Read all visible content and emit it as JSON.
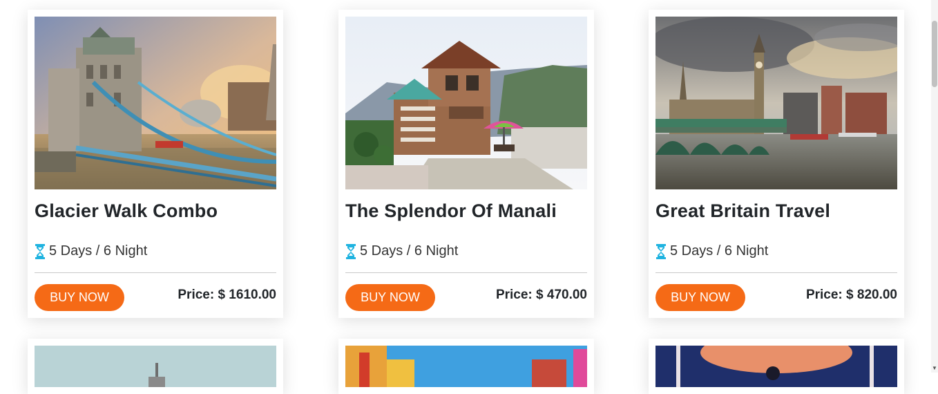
{
  "tours": [
    {
      "title": "Glacier Walk Combo",
      "duration": "5 Days / 6 Night",
      "button": "BUY NOW",
      "price": "Price: $ 1610.00",
      "image": "tower-bridge-photo"
    },
    {
      "title": "The Splendor Of Manali",
      "duration": "5 Days / 6 Night",
      "button": "BUY NOW",
      "price": "Price: $ 470.00",
      "image": "manali-chalet-photo"
    },
    {
      "title": "Great Britain Travel",
      "duration": "5 Days / 6 Night",
      "button": "BUY NOW",
      "price": "Price: $ 820.00",
      "image": "big-ben-photo"
    }
  ],
  "icons": {
    "duration": "hourglass-icon"
  },
  "colors": {
    "accent": "#f56a16",
    "icon": "#1fb3e0",
    "text": "#212529"
  }
}
